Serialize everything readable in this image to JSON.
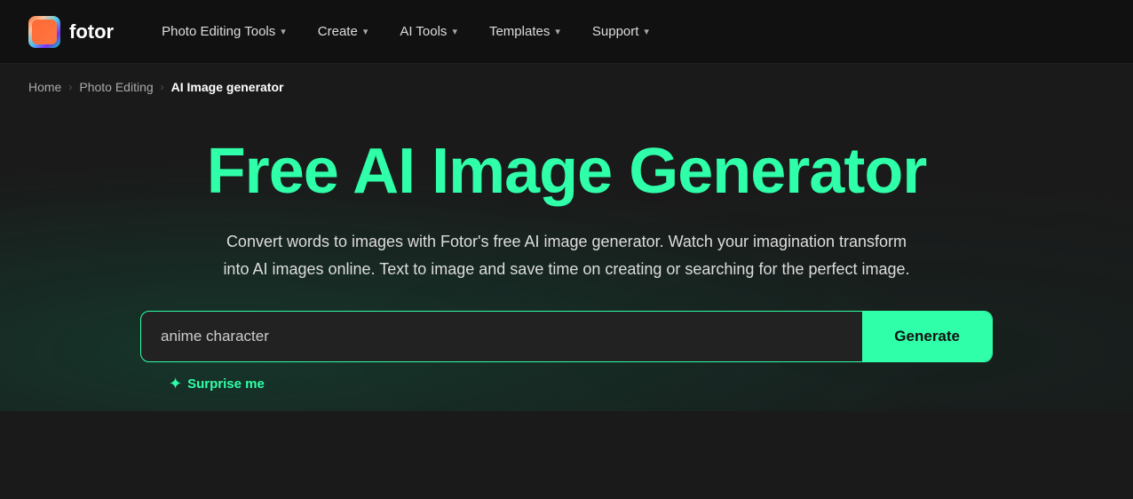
{
  "logo": {
    "text": "fotor"
  },
  "nav": {
    "items": [
      {
        "id": "photo-editing-tools",
        "label": "Photo Editing Tools",
        "hasDropdown": true
      },
      {
        "id": "create",
        "label": "Create",
        "hasDropdown": true
      },
      {
        "id": "ai-tools",
        "label": "AI Tools",
        "hasDropdown": true
      },
      {
        "id": "templates",
        "label": "Templates",
        "hasDropdown": true
      },
      {
        "id": "support",
        "label": "Support",
        "hasDropdown": true
      }
    ]
  },
  "breadcrumb": {
    "items": [
      {
        "label": "Home",
        "id": "home"
      },
      {
        "label": "Photo Editing",
        "id": "photo-editing"
      },
      {
        "label": "AI Image generator",
        "id": "ai-image-generator"
      }
    ]
  },
  "hero": {
    "title": "Free AI Image Generator",
    "description": "Convert words to images with Fotor's free AI image generator. Watch your imagination transform into AI images online. Text to image and save time on creating or searching for the perfect image.",
    "input_placeholder": "anime character",
    "input_value": "anime character",
    "generate_label": "Generate",
    "surprise_label": "Surprise me"
  }
}
